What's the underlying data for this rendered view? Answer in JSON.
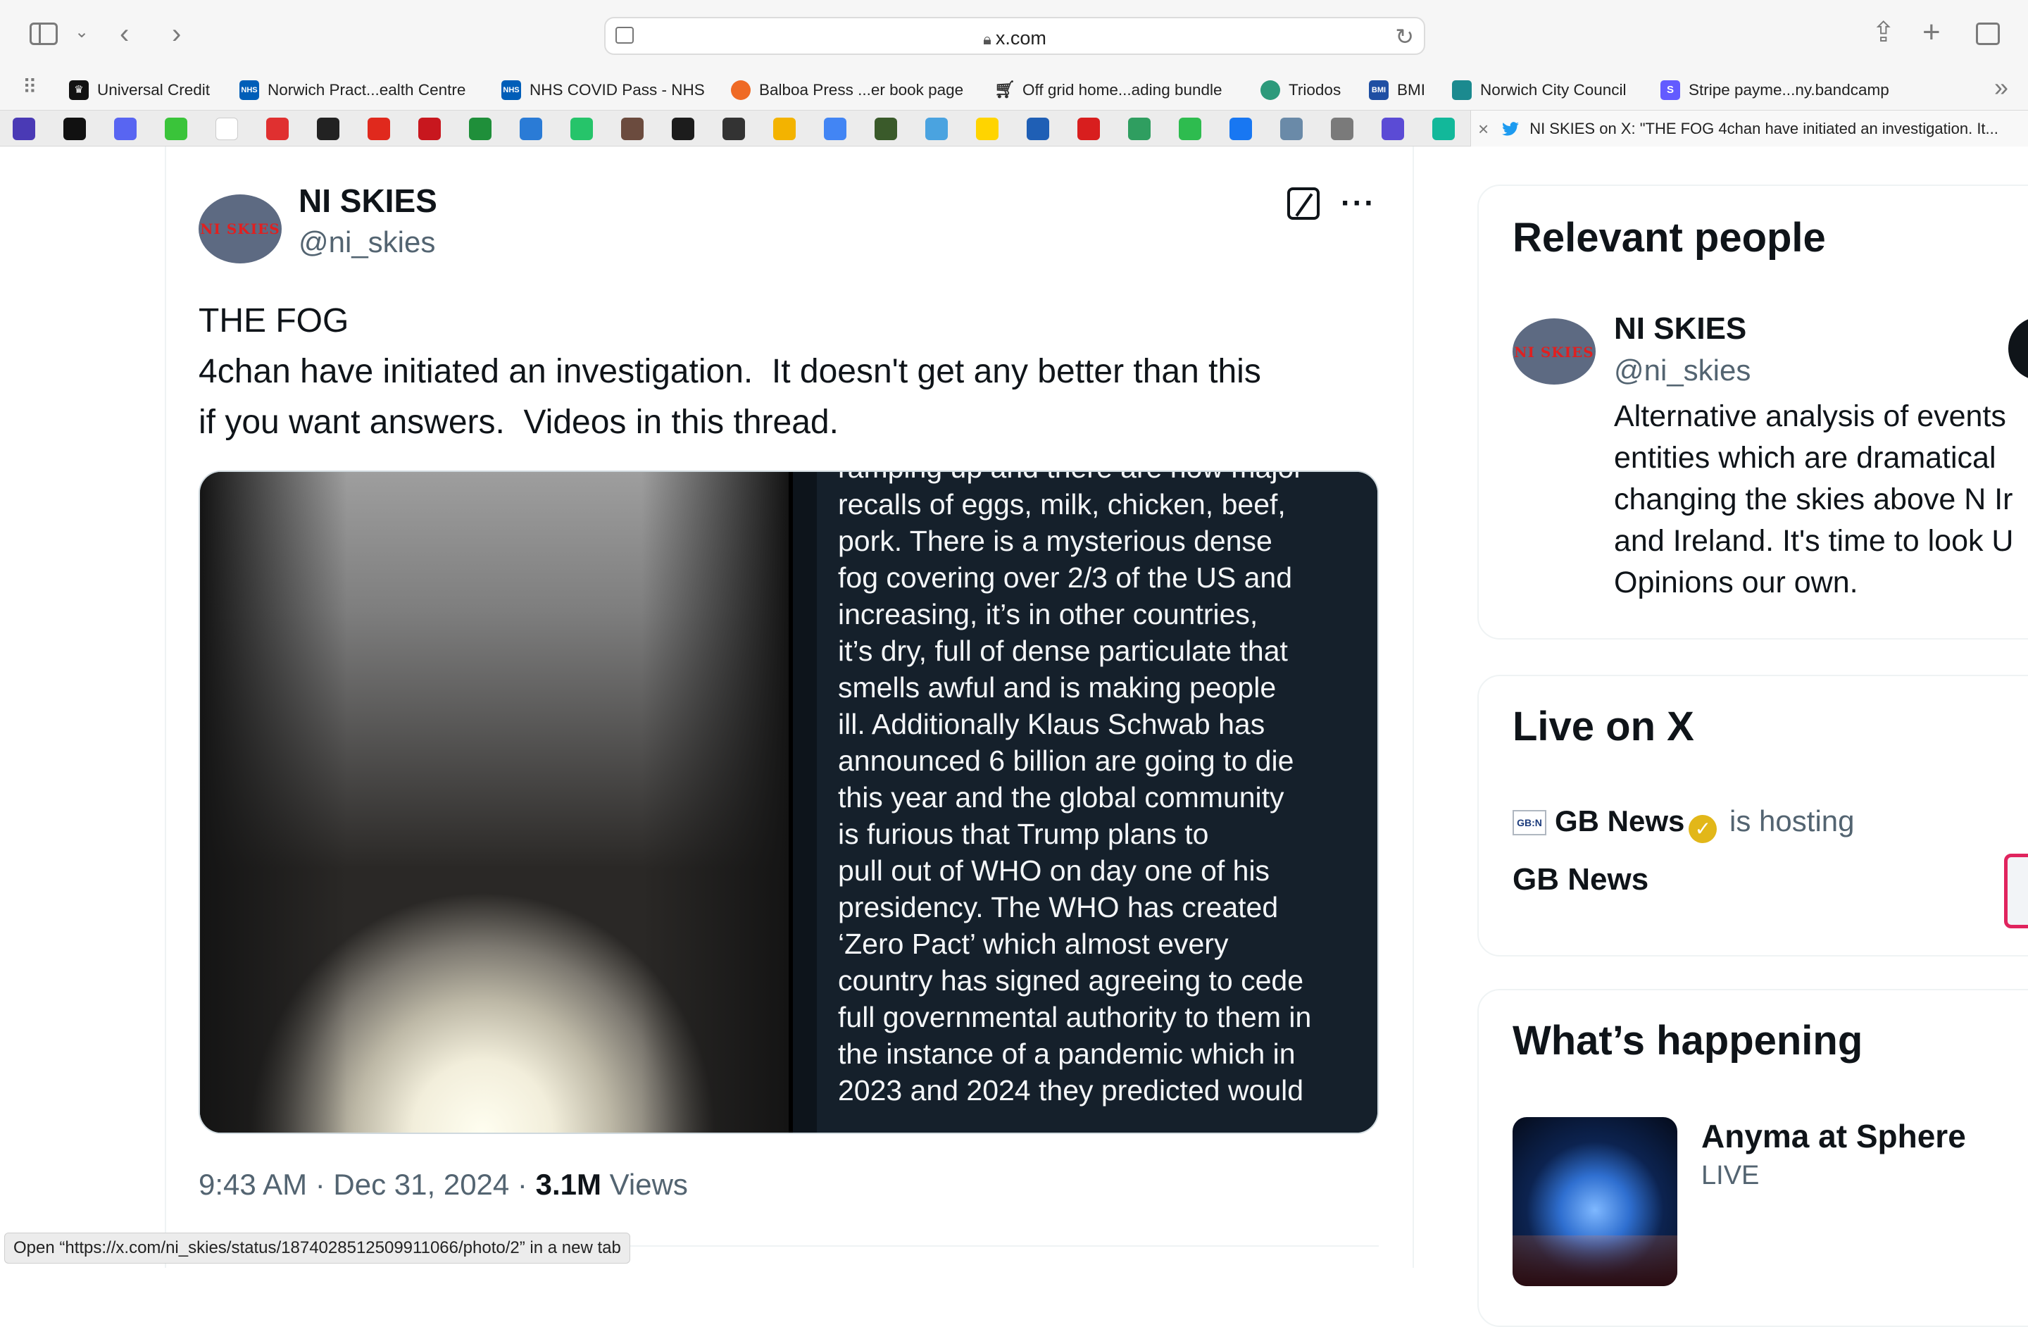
{
  "browser": {
    "url_display": "x.com",
    "bookmarks": [
      {
        "label": "Universal Credit",
        "icon": "crown-icon",
        "color": "#111111"
      },
      {
        "label": "Norwich Pract...ealth Centre",
        "icon": "nhs-icon",
        "color": "#005eb8"
      },
      {
        "label": "NHS COVID Pass - NHS",
        "icon": "nhs-icon",
        "color": "#005eb8"
      },
      {
        "label": "Balboa Press ...er book page",
        "icon": "balboa-icon",
        "color": "#ef6a25"
      },
      {
        "label": "Off grid home...ading bundle",
        "icon": "cart-icon",
        "color": "#333333"
      },
      {
        "label": "Triodos",
        "icon": "triodos-icon",
        "color": "#2d9a7b"
      },
      {
        "label": "BMI",
        "icon": "bmi-icon",
        "color": "#1f4fa3"
      },
      {
        "label": "Norwich City Council",
        "icon": "council-icon",
        "color": "#1b8a8f"
      },
      {
        "label": "Stripe payme...ny.bandcamp",
        "icon": "stripe-icon",
        "color": "#635bff"
      }
    ],
    "pinned_tab_colors": [
      "#4a3ab5",
      "#111111",
      "#5865f2",
      "#3ac43a",
      "#ffffff",
      "#e03030",
      "#222222",
      "#e0291d",
      "#c8171e",
      "#1f8f3a",
      "#2a7bd6",
      "#26c46a",
      "#6b4b3e",
      "#1c1c1c",
      "#333333",
      "#f3b300",
      "#4285f4",
      "#3a5a2a",
      "#4aa3e0",
      "#ffd400",
      "#1f5fb5",
      "#d81e1e",
      "#2f9e60",
      "#2ebc4f",
      "#1877f2",
      "#6a8aa8",
      "#7a7a7a",
      "#5b4bd5",
      "#12b89a"
    ],
    "active_tab_title": "NI SKIES on X: \"THE FOG 4chan have initiated an investigation. It...",
    "status_bar_text": "Open “https://x.com/ni_skies/status/1874028512509911066/photo/2” in a new tab"
  },
  "tweet": {
    "author_name": "NI SKIES",
    "author_handle": "@ni_skies",
    "avatar_text": "NI SKIES",
    "text": "THE FOG\n4chan have initiated an investigation.  It doesn't get any better than this\nif you want answers.  Videos in this thread.",
    "image_text": "ramping up and there are now major\nrecalls of eggs, milk, chicken, beef,\npork. There is a mysterious dense\nfog covering over 2/3 of the US and\nincreasing, it’s in other countries,\nit’s dry, full of dense particulate that\nsmells awful and is making people\nill. Additionally Klaus Schwab has\nannounced 6 billion are going to die\nthis year and the global community\nis furious that Trump plans to\npull out of WHO on day one of his\npresidency. The WHO has created\n‘Zero Pact’ which almost every\ncountry has signed agreeing to cede\nfull governmental authority to them in\nthe instance of a pandemic which in\n2023 and 2024 they predicted would",
    "timestamp": "9:43 AM · Dec 31, 2024 · ",
    "views_count": "3.1M",
    "views_label": " Views"
  },
  "sidebar": {
    "relevant_people": {
      "title": "Relevant people",
      "name": "NI SKIES",
      "handle": "@ni_skies",
      "bio": "Alternative analysis of events\nentities which are dramatical\nchanging the skies above N Ir\nand Ireland. It's time to look U\nOpinions our own."
    },
    "live": {
      "title": "Live on X",
      "host_icon_text": "GB:N",
      "host_name": "GB News",
      "host_suffix": " is hosting",
      "broadcast_title": "GB News"
    },
    "happening": {
      "title": "What’s happening",
      "trend_title": "Anyma at Sphere",
      "trend_status": "LIVE"
    }
  }
}
